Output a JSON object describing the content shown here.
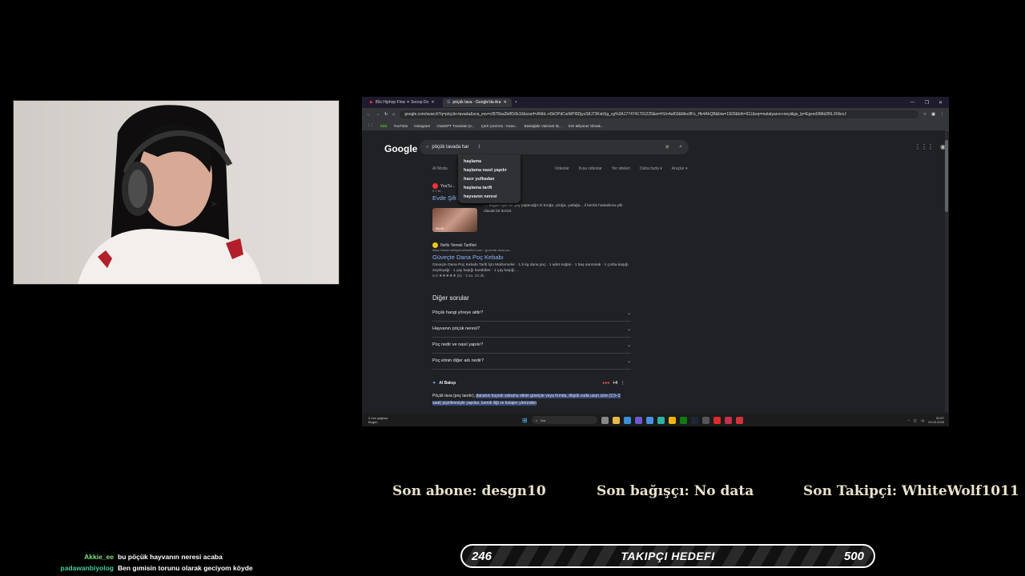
{
  "browser": {
    "tabs": [
      {
        "label": "80s Hiphop Flow ✦ Snoop Do",
        "active": false
      },
      {
        "label": "pöçük tava - Google'da Ara",
        "active": true
      }
    ],
    "new_tab": "+",
    "url": "google.com/search?q=pöçük+tavada&sca_esv=cf975ba2b8f16b10&sxsrf=ANbL-n5kOPdCwWPl0DjyzS8J73KsbSg_cg%3A1774741791225&ei=HUn4af03&Mec8Fs_Hk4AhQB&biw=1920&bih=911&oq=malatyanın+neyi&gs_lp=Egxnd3Mtd2l6LXNlcnJ",
    "bookmarks": [
      "Kick",
      "YouTube",
      "Instagram",
      "ChatGPT Translate (e...",
      "Çarlı Çevirme - Karaı...",
      "Bastağide Valorant İŞ...",
      "Kim Milyoner Olmak..."
    ]
  },
  "google": {
    "logo": "Google",
    "query": "pöçük tavada har",
    "suggestions": [
      "haşlama",
      "haşlama nasıl yapılır",
      "hazır yufkadan",
      "haşlama tarifi",
      "hayvanın neresi"
    ],
    "filters": [
      "AI Modu",
      "Videolar",
      "Kısa videolar",
      "Yer siteleri",
      "Daha fazla ▾",
      "Araçlar ▾"
    ],
    "results": [
      {
        "site": "YouTu...",
        "date": "2.7 M...",
        "title": "Evde Şifr... ...p Hastalığı Unut",
        "snippet": "..., bugün öyle bir şey yapacağız ki kırığa, çıkığa, çatlağa ...il kemik hastalıkna yıllı olacak bir lezzet.",
        "duration": "08:05"
      },
      {
        "site": "Nefis Yemek Tarifleri",
        "url": "https://www.nefisyemektarifleri.com › guvecte-dana-po...",
        "title": "Güveçte Dana Poç Kebabı",
        "snippet": "Güveçte Dana Poç Kebabı Tarifi İçin Malzemeler · 1.5 kg dana poç · 1 adet soğan · 1 baş sarımsak · 1 çorba kaşığı zeytinyağı · 1 çay kaşığı karabiber · 1 çay kaşığı ...",
        "rating": "5.0 ★★★★★ (6) · 3 sa. 10 dk."
      }
    ],
    "other_questions_title": "Diğer sorular",
    "questions": [
      "Pöçük hangi yöreye aittir?",
      "Hayvanın pöçük neresi?",
      "Poç nedir ve nasıl yapılır?",
      "Poç etinin diğer adı nedir?"
    ],
    "ai": {
      "label": "AI Bakışı",
      "count": "+4",
      "lead": "Pöçük tava (poç tandır),",
      "highlight": "dananın kuyruk sokumu etinin güveçte veya fırında, düşük ısıda uzun süre (2,5–3 saat) pişirilmesiyle yapılan, kemik iliği ve kolajen yönünden"
    }
  },
  "taskbar": {
    "weather": "2 mm yağmur",
    "weather_sub": "Bugün",
    "search_label": "Ara",
    "time": "02:57",
    "date": "29.03.2026"
  },
  "overlay": {
    "last_sub": "Son abone: desgn10",
    "last_donor": "Son bağışçı: No data",
    "last_follower": "Son Takipçi: WhiteWolf1011"
  },
  "chat": [
    {
      "user": "Akkie_ee",
      "msg": "bu pöçük hayvanın neresi acaba",
      "color": "#7fe07f"
    },
    {
      "user": "padawanbiyolog",
      "msg": "Ben gımisin torunu olarak geciyom köyde",
      "color": "#3fcf9f"
    }
  ],
  "goal": {
    "current": "246",
    "label": "TAKIPÇI HEDEFI",
    "target": "500",
    "progress_fraction": 0.492
  }
}
